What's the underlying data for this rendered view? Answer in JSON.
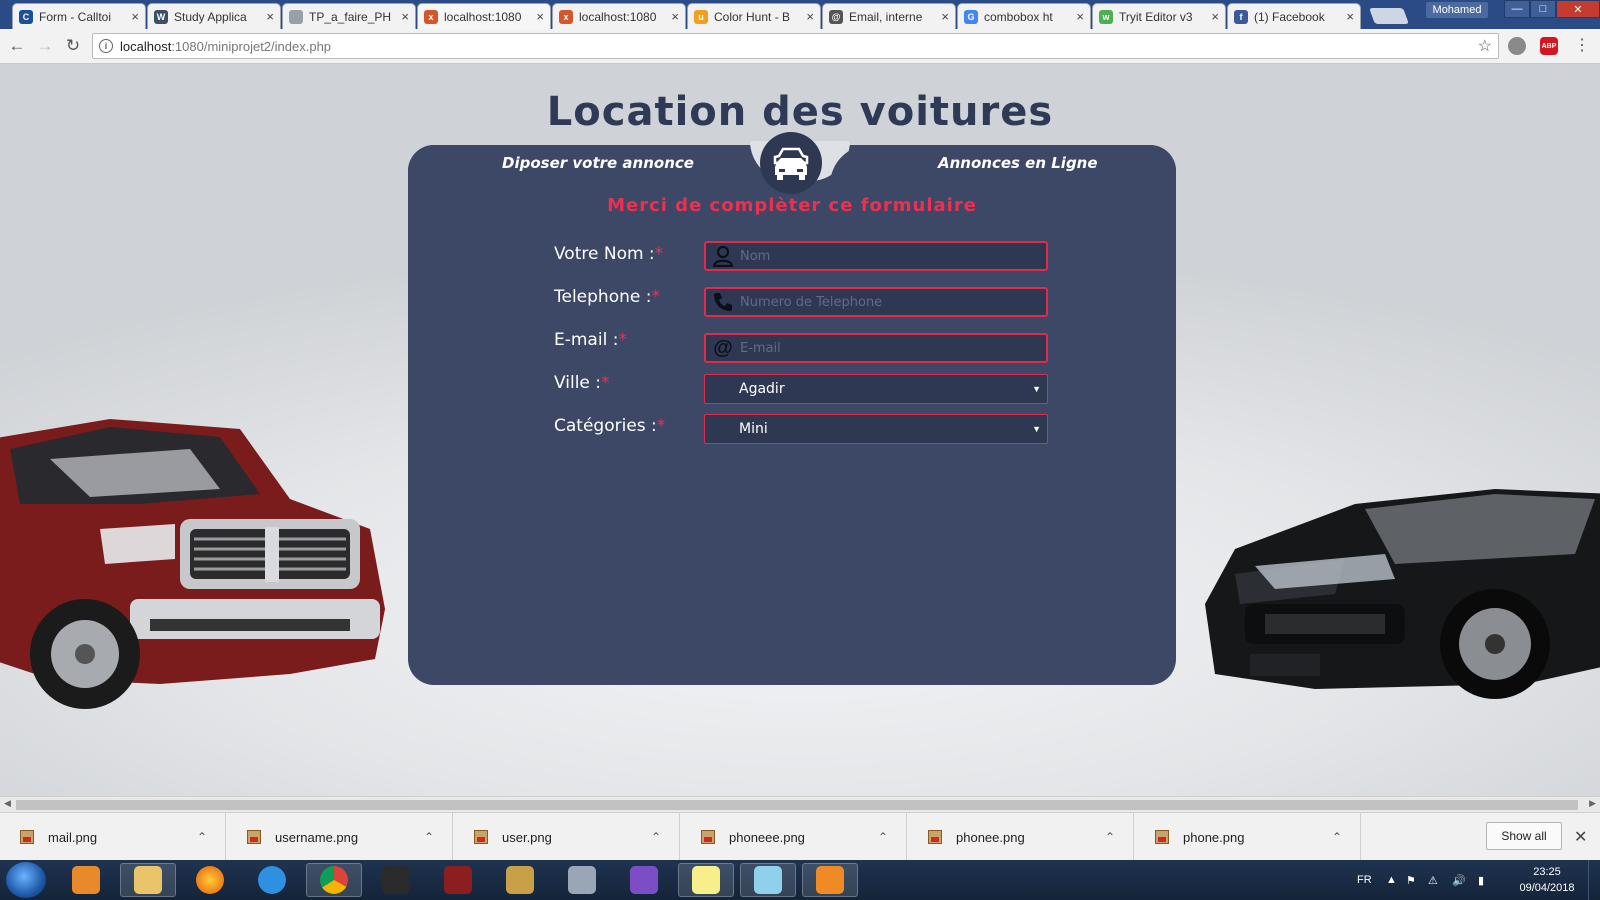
{
  "browser": {
    "tabs": [
      {
        "title": "Form - Calltoi",
        "favicon_color": "#1b4f9c",
        "favicon_glyph": "C"
      },
      {
        "title": "Study Applica",
        "favicon_color": "#3d4f66",
        "favicon_glyph": "W"
      },
      {
        "title": "TP_a_faire_PH",
        "favicon_color": "#9aa0a8",
        "favicon_glyph": ""
      },
      {
        "title": "localhost:1080",
        "favicon_color": "#d2572a",
        "favicon_glyph": "x"
      },
      {
        "title": "localhost:1080",
        "favicon_color": "#d2572a",
        "favicon_glyph": "x"
      },
      {
        "title": "Color Hunt - B",
        "favicon_color": "#f0a020",
        "favicon_glyph": "u"
      },
      {
        "title": "Email, interne",
        "favicon_color": "#555555",
        "favicon_glyph": "@"
      },
      {
        "title": "combobox ht",
        "favicon_color": "#4285f4",
        "favicon_glyph": "G"
      },
      {
        "title": "Tryit Editor v3",
        "favicon_color": "#4caf50",
        "favicon_glyph": "w"
      },
      {
        "title": "(1) Facebook",
        "favicon_color": "#3b5998",
        "favicon_glyph": "f"
      }
    ],
    "active_tab_index": 3,
    "profile_name": "Mohamed",
    "url_host": "localhost",
    "url_rest": ":1080/miniprojet2/index.php",
    "abp_label": "ABP"
  },
  "page": {
    "title": "Location des voitures",
    "tab_left": "Diposer votre annonce",
    "tab_right": "Annonces en Ligne",
    "form_heading": "Merci de complèter ce formulaire",
    "required_mark": "*",
    "fields": {
      "nom": {
        "label": "Votre Nom :",
        "placeholder": "Nom",
        "icon": "user-icon"
      },
      "telephone": {
        "label": "Telephone :",
        "placeholder": "Numero de Telephone",
        "icon": "phone-icon"
      },
      "email": {
        "label": "E-mail :",
        "placeholder": "E-mail",
        "icon": "at-icon"
      },
      "ville": {
        "label": "Ville :",
        "value": "Agadir"
      },
      "categories": {
        "label": "Catégories :",
        "value": "Mini"
      }
    },
    "colors": {
      "panel": "#3d4766",
      "accent": "#ee2f4f",
      "field_bg": "#2f3852"
    }
  },
  "downloads": {
    "items": [
      "mail.png",
      "username.png",
      "user.png",
      "phoneee.png",
      "phonee.png",
      "phone.png"
    ],
    "show_all": "Show all"
  },
  "taskbar": {
    "language": "FR",
    "time": "23:25",
    "date": "09/04/2018"
  }
}
